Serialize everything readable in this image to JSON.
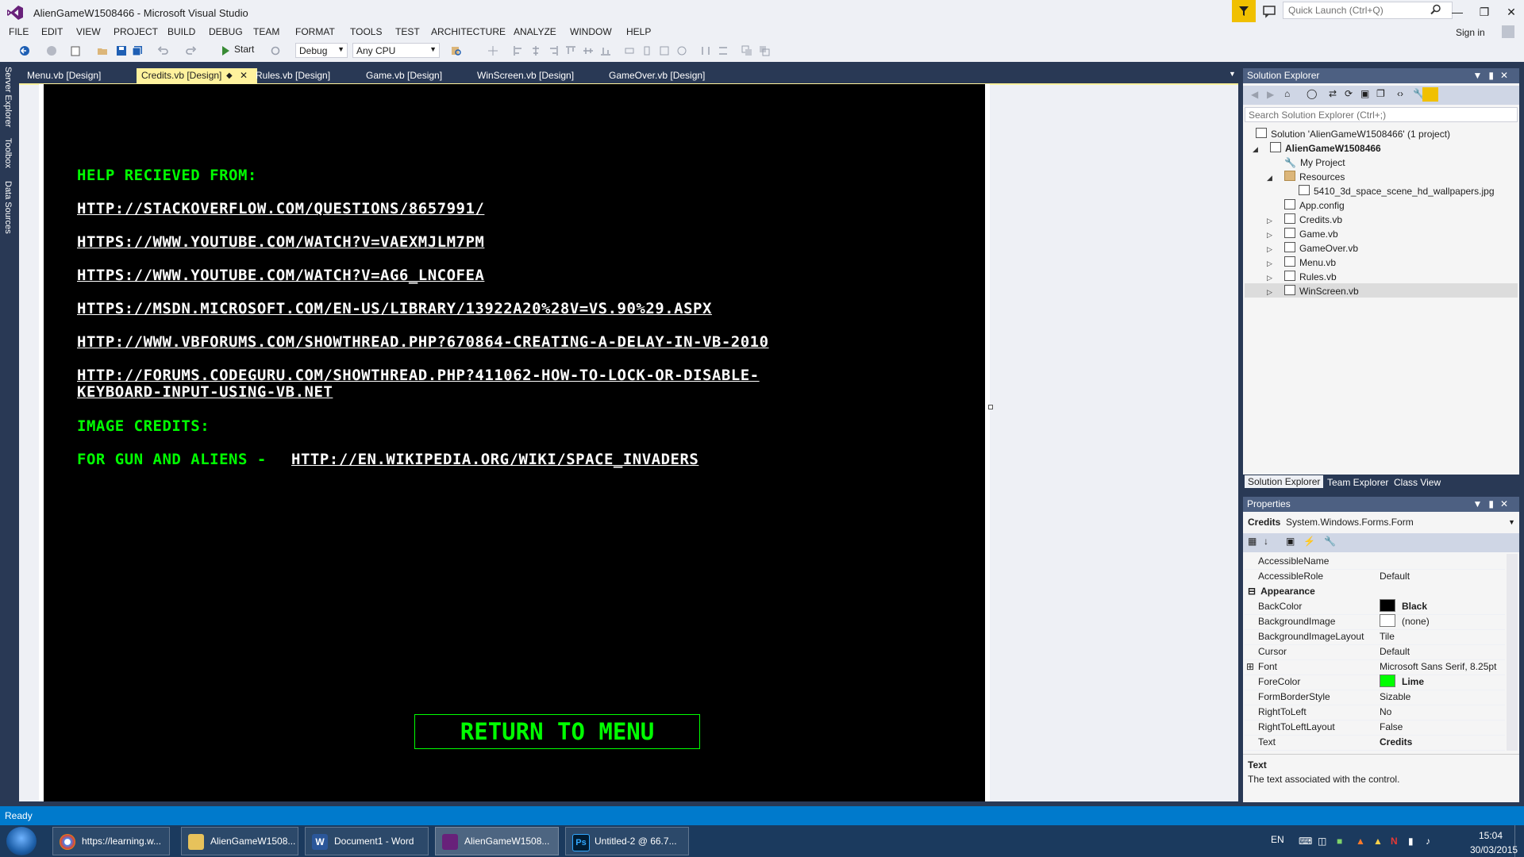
{
  "window": {
    "title": "AlienGameW1508466 - Microsoft Visual Studio",
    "quick_launch_placeholder": "Quick Launch (Ctrl+Q)",
    "sign_in": "Sign in"
  },
  "menu": [
    "FILE",
    "EDIT",
    "VIEW",
    "PROJECT",
    "BUILD",
    "DEBUG",
    "TEAM",
    "FORMAT",
    "TOOLS",
    "TEST",
    "ARCHITECTURE",
    "ANALYZE",
    "WINDOW",
    "HELP"
  ],
  "toolbar": {
    "start_label": "Start",
    "config": "Debug",
    "platform": "Any CPU"
  },
  "left_rail": [
    "Server Explorer",
    "Toolbox",
    "Data Sources"
  ],
  "tabs": [
    "Menu.vb [Design]",
    "Credits.vb [Design]",
    "Rules.vb [Design]",
    "Game.vb [Design]",
    "WinScreen.vb [Design]",
    "GameOver.vb [Design]"
  ],
  "form": {
    "help_heading": "Help recieved from:",
    "links": [
      "http://stackoverflow.com/questions/8657991/",
      "https://www.youtube.com/watch?v=vaEXmJLm7PM",
      "https://www.youtube.com/watch?v=AG6_LnCOfEA",
      "https://msdn.microsoft.com/en-us/library/13922a20%28v=vs.90%29.aspx",
      "http://www.vbforums.com/showthread.php?670864-Creating-a-delay-in-VB-2010",
      "http://forums.codeguru.com/showthread.php?411062-how-to-lock-or-disable-",
      "keyboard-input-using-vb.net"
    ],
    "image_heading": "Image Credits:",
    "gun_label": "For Gun and Aliens - ",
    "gun_link": "http://en.wikipedia.org/wiki/Space_Invaders",
    "return_button": "Return To Menu"
  },
  "solution_explorer": {
    "title": "Solution Explorer",
    "search_placeholder": "Search Solution Explorer (Ctrl+;)",
    "solution": "Solution 'AlienGameW1508466' (1 project)",
    "project": "AlienGameW1508466",
    "items": [
      "My Project",
      "Resources",
      "5410_3d_space_scene_hd_wallpapers.jpg",
      "App.config",
      "Credits.vb",
      "Game.vb",
      "GameOver.vb",
      "Menu.vb",
      "Rules.vb",
      "WinScreen.vb"
    ],
    "bottom_tabs": [
      "Solution Explorer",
      "Team Explorer",
      "Class View"
    ]
  },
  "properties": {
    "title": "Properties",
    "object_name": "Credits",
    "object_type": "System.Windows.Forms.Form",
    "rows": [
      {
        "name": "AccessibleName",
        "value": ""
      },
      {
        "name": "AccessibleRole",
        "value": "Default"
      },
      {
        "category": "Appearance"
      },
      {
        "name": "BackColor",
        "value": "Black",
        "swatch": "#000000",
        "bold": true
      },
      {
        "name": "BackgroundImage",
        "value": "(none)",
        "swatch": "#ffffff"
      },
      {
        "name": "BackgroundImageLayout",
        "value": "Tile"
      },
      {
        "name": "Cursor",
        "value": "Default"
      },
      {
        "name": "Font",
        "value": "Microsoft Sans Serif, 8.25pt",
        "expand": true
      },
      {
        "name": "ForeColor",
        "value": "Lime",
        "swatch": "#00ff00",
        "bold": true
      },
      {
        "name": "FormBorderStyle",
        "value": "Sizable"
      },
      {
        "name": "RightToLeft",
        "value": "No"
      },
      {
        "name": "RightToLeftLayout",
        "value": "False"
      },
      {
        "name": "Text",
        "value": "Credits",
        "bold": true
      }
    ],
    "desc_title": "Text",
    "desc_text": "The text associated with the control."
  },
  "status": "Ready",
  "taskbar": {
    "items": [
      "https://learning.w...",
      "AlienGameW1508...",
      "Document1 - Word",
      "AlienGameW1508...",
      "Untitled-2 @ 66.7..."
    ],
    "lang": "EN",
    "time": "15:04",
    "date": "30/03/2015"
  }
}
